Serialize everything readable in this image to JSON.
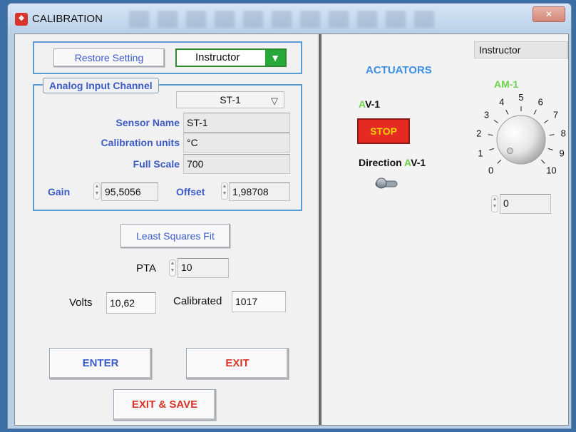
{
  "window": {
    "title": "CALIBRATION",
    "icon": "app-red-icon",
    "close_glyph": "✕"
  },
  "top": {
    "restore_label": "Restore Setting",
    "user_select": "Instructor"
  },
  "channel": {
    "group_label": "Analog Input Channel",
    "selected": "ST-1",
    "sensor_name_label": "Sensor Name",
    "sensor_name": "ST-1",
    "units_label": "Calibration units",
    "units": "°C",
    "full_scale_label": "Full Scale",
    "full_scale": "700",
    "gain_label": "Gain",
    "gain": "95,5056",
    "offset_label": "Offset",
    "offset": "1,98708"
  },
  "fit": {
    "least_squares_label": "Least Squares  Fit",
    "pta_label": "PTA",
    "pta": "10",
    "volts_label": "Volts",
    "volts": "10,62",
    "calibrated_label": "Calibrated",
    "calibrated": "1017"
  },
  "buttons": {
    "enter": "ENTER",
    "exit": "EXIT",
    "exit_save": "EXIT & SAVE"
  },
  "actuators": {
    "user_label": "Instructor",
    "heading": "ACTUATORS",
    "av_prefix": "A",
    "av_suffix": "V-1",
    "stop_label": "STOP",
    "direction_prefix": "Direction ",
    "direction_a": "A",
    "direction_suffix": "V-1",
    "am_label": "AM-1",
    "am_value": "0",
    "knob_value": 0,
    "knob_ticks": [
      "0",
      "1",
      "2",
      "3",
      "4",
      "5",
      "6",
      "7",
      "8",
      "9",
      "10"
    ]
  },
  "colors": {
    "accent_blue": "#3c5bc8",
    "stop_red": "#e42a22",
    "stop_text": "#f0d000",
    "green": "#6ad44a",
    "dropdown_green": "#28a838"
  }
}
